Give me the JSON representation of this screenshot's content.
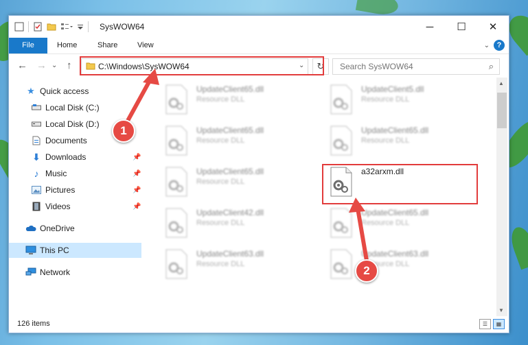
{
  "window": {
    "title": "SysWOW64"
  },
  "ribbon": {
    "tabs": [
      "File",
      "Home",
      "Share",
      "View"
    ]
  },
  "address": {
    "path": "C:\\Windows\\SysWOW64"
  },
  "search": {
    "placeholder": "Search SysWOW64"
  },
  "sidebar": {
    "items": [
      {
        "label": "Quick access",
        "icon": "star-icon"
      },
      {
        "label": "Local Disk (C:)",
        "icon": "drive-icon"
      },
      {
        "label": "Local Disk (D:)",
        "icon": "drive-icon"
      },
      {
        "label": "Documents",
        "icon": "document-icon"
      },
      {
        "label": "Downloads",
        "icon": "download-icon"
      },
      {
        "label": "Music",
        "icon": "music-icon"
      },
      {
        "label": "Pictures",
        "icon": "pictures-icon"
      },
      {
        "label": "Videos",
        "icon": "video-icon"
      },
      {
        "label": "OneDrive",
        "icon": "cloud-icon"
      },
      {
        "label": "This PC",
        "icon": "computer-icon"
      },
      {
        "label": "Network",
        "icon": "network-icon"
      }
    ]
  },
  "files": [
    {
      "name": "UpdateClient65.dll",
      "type": "Resource DLL"
    },
    {
      "name": "UpdateClient5.dll",
      "type": "Resource DLL"
    },
    {
      "name": "UpdateClient65.dll",
      "type": "Resource DLL"
    },
    {
      "name": "UpdateClient65.dll",
      "type": "Resource DLL"
    },
    {
      "name": "UpdateClient65.dll",
      "type": "Resource DLL"
    },
    {
      "name": "a32arxm.dll",
      "type": ""
    },
    {
      "name": "UpdateClient42.dll",
      "type": "Resource DLL"
    },
    {
      "name": "UpdateClient65.dll",
      "type": "Resource DLL"
    },
    {
      "name": "UpdateClient63.dll",
      "type": "Resource DLL"
    },
    {
      "name": "UpdateClient63.dll",
      "type": "Resource DLL"
    }
  ],
  "status": {
    "item_count": "126 items"
  },
  "annotations": {
    "step1": "1",
    "step2": "2"
  },
  "colors": {
    "accent": "#1979ca",
    "highlight": "#e23b3b",
    "selected": "#cce8ff"
  }
}
